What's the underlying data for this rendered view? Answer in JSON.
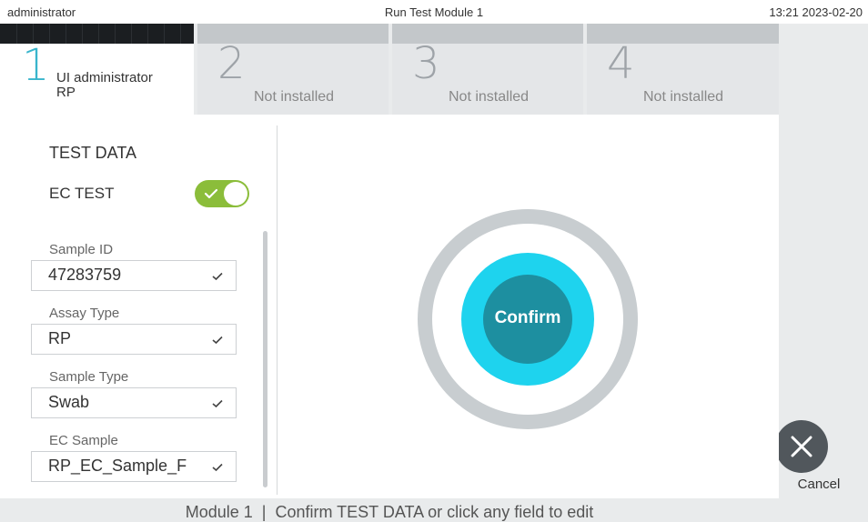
{
  "topbar": {
    "user": "administrator",
    "title": "Run Test Module 1",
    "datetime": "13:21 2023-02-20"
  },
  "tabs": [
    {
      "number": "1",
      "line1": "UI administrator",
      "line2": "RP",
      "active": true
    },
    {
      "number": "2",
      "label": "Not installed",
      "active": false
    },
    {
      "number": "3",
      "label": "Not installed",
      "active": false
    },
    {
      "number": "4",
      "label": "Not installed",
      "active": false
    }
  ],
  "test_data": {
    "title": "TEST DATA",
    "ec_test_label": "EC TEST",
    "ec_test_enabled": true,
    "fields": [
      {
        "label": "Sample ID",
        "value": "47283759"
      },
      {
        "label": "Assay Type",
        "value": "RP"
      },
      {
        "label": "Sample Type",
        "value": "Swab"
      },
      {
        "label": "EC Sample",
        "value": "RP_EC_Sample_F"
      }
    ]
  },
  "confirm": {
    "label": "Confirm"
  },
  "cancel": {
    "label": "Cancel"
  },
  "footer": {
    "message": "Module 1  |  Confirm TEST DATA or click any field to edit"
  },
  "colors": {
    "accent": "#1ed3ee",
    "confirm": "#1d8fa0",
    "toggle_on": "#8bbd3a",
    "cancel": "#51575c"
  }
}
